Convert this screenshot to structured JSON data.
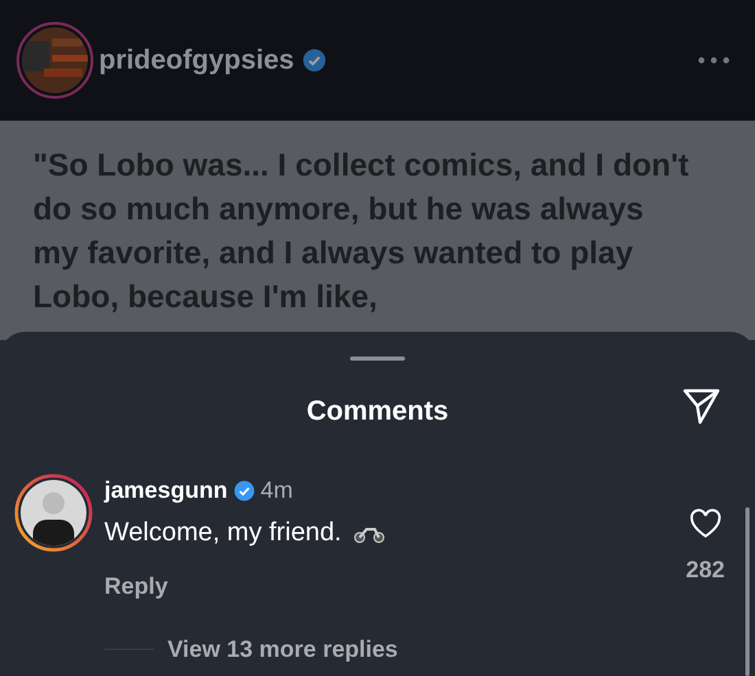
{
  "post": {
    "username": "prideofgypsies",
    "verified": true,
    "caption": "\"So Lobo was... I collect comics, and I don't do so much anymore, but he was always my favorite, and I always wanted to play Lobo, because I'm like,"
  },
  "comments_sheet": {
    "title": "Comments",
    "comments": [
      {
        "username": "jamesgunn",
        "verified": true,
        "time": "4m",
        "text": "Welcome, my friend.",
        "reply_label": "Reply",
        "likes": "282",
        "liked": false,
        "view_replies": "View 13 more replies"
      }
    ]
  }
}
